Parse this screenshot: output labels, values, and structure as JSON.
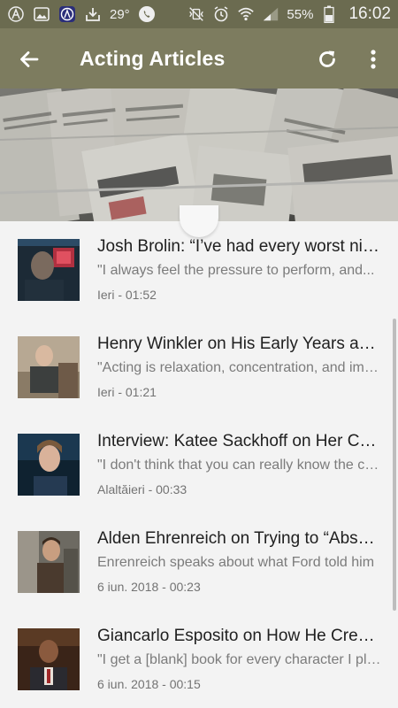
{
  "status_bar": {
    "temperature": "29°",
    "battery": "55%",
    "time": "16:02"
  },
  "app_bar": {
    "title": "Acting Articles"
  },
  "colors": {
    "status_bar": "#6b6b50",
    "app_bar": "#7d7c5f",
    "background": "#f3f3f3"
  },
  "articles": [
    {
      "title": "Josh Brolin: “I’ve had every worst nightmare”",
      "quote": "\"I always feel the pressure to perform, and...",
      "date": "Ieri - 01:52"
    },
    {
      "title": "Henry Winkler on His Early Years as an Actor",
      "quote": "\"Acting is relaxation, concentration, and imagination\"",
      "date": "Ieri - 01:21"
    },
    {
      "title": "Interview: Katee Sackhoff on Her Career",
      "quote": "\"I don't think that you can really know the character\"",
      "date": "Alaltăieri - 00:33"
    },
    {
      "title": "Alden Ehrenreich on Trying to “Absorb” Ford",
      "quote": "Enrenreich speaks about what Ford told him",
      "date": "6 iun. 2018 - 00:23"
    },
    {
      "title": "Giancarlo Esposito on How He Creates Characters",
      "quote": "\"I get a [blank] book for every character I play\"",
      "date": "6 iun. 2018 - 00:15"
    }
  ]
}
